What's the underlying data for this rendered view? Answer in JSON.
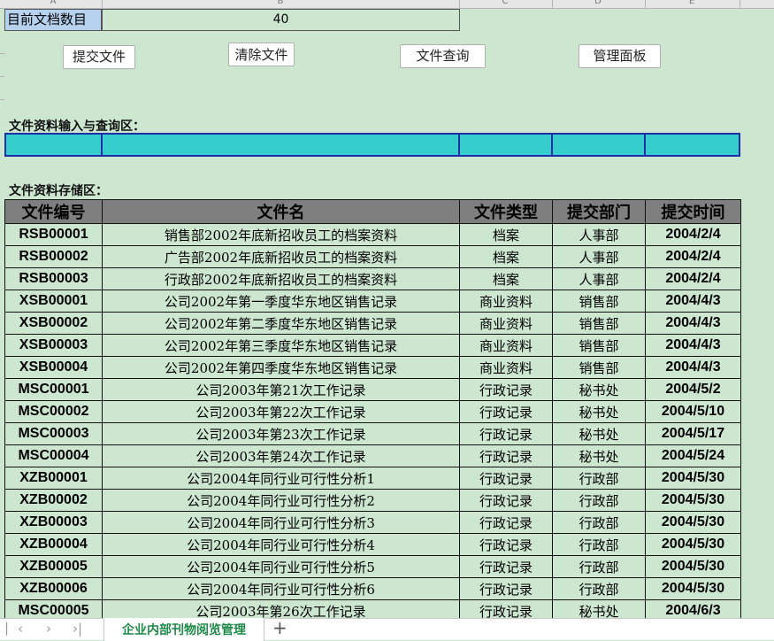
{
  "column_letters": [
    "A",
    "B",
    "C",
    "D",
    "E"
  ],
  "count": {
    "label": "目前文档数目",
    "value": "40"
  },
  "buttons": {
    "submit": "提交文件",
    "clear": "清除文件",
    "query": "文件查询",
    "admin": "管理面板"
  },
  "input_section_title": "文件资料输入与查询区：",
  "storage_section_title": "文件资料存储区：",
  "table": {
    "headers": [
      "文件编号",
      "文件名",
      "文件类型",
      "提交部门",
      "提交时间"
    ],
    "rows": [
      [
        "RSB00001",
        "销售部2002年底新招收员工的档案资料",
        "档案",
        "人事部",
        "2004/2/4"
      ],
      [
        "RSB00002",
        "广告部2002年底新招收员工的档案资料",
        "档案",
        "人事部",
        "2004/2/4"
      ],
      [
        "RSB00003",
        "行政部2002年底新招收员工的档案资料",
        "档案",
        "人事部",
        "2004/2/4"
      ],
      [
        "XSB00001",
        "公司2002年第一季度华东地区销售记录",
        "商业资料",
        "销售部",
        "2004/4/3"
      ],
      [
        "XSB00002",
        "公司2002年第二季度华东地区销售记录",
        "商业资料",
        "销售部",
        "2004/4/3"
      ],
      [
        "XSB00003",
        "公司2002年第三季度华东地区销售记录",
        "商业资料",
        "销售部",
        "2004/4/3"
      ],
      [
        "XSB00004",
        "公司2002年第四季度华东地区销售记录",
        "商业资料",
        "销售部",
        "2004/4/3"
      ],
      [
        "MSC00001",
        "公司2003年第21次工作记录",
        "行政记录",
        "秘书处",
        "2004/5/2"
      ],
      [
        "MSC00002",
        "公司2003年第22次工作记录",
        "行政记录",
        "秘书处",
        "2004/5/10"
      ],
      [
        "MSC00003",
        "公司2003年第23次工作记录",
        "行政记录",
        "秘书处",
        "2004/5/17"
      ],
      [
        "MSC00004",
        "公司2003年第24次工作记录",
        "行政记录",
        "秘书处",
        "2004/5/24"
      ],
      [
        "XZB00001",
        "公司2004年同行业可行性分析1",
        "行政记录",
        "行政部",
        "2004/5/30"
      ],
      [
        "XZB00002",
        "公司2004年同行业可行性分析2",
        "行政记录",
        "行政部",
        "2004/5/30"
      ],
      [
        "XZB00003",
        "公司2004年同行业可行性分析3",
        "行政记录",
        "行政部",
        "2004/5/30"
      ],
      [
        "XZB00004",
        "公司2004年同行业可行性分析4",
        "行政记录",
        "行政部",
        "2004/5/30"
      ],
      [
        "XZB00005",
        "公司2004年同行业可行性分析5",
        "行政记录",
        "行政部",
        "2004/5/30"
      ],
      [
        "XZB00006",
        "公司2004年同行业可行性分析6",
        "行政记录",
        "行政部",
        "2004/5/30"
      ],
      [
        "MSC00005",
        "公司2003年第26次工作记录",
        "行政记录",
        "秘书处",
        "2004/6/3"
      ]
    ]
  },
  "sheet_tabs": {
    "active": "企业内部刊物阅览管理"
  },
  "nav_icons": [
    "first-sheet-icon",
    "prev-sheet-icon",
    "next-sheet-icon",
    "last-sheet-icon"
  ]
}
